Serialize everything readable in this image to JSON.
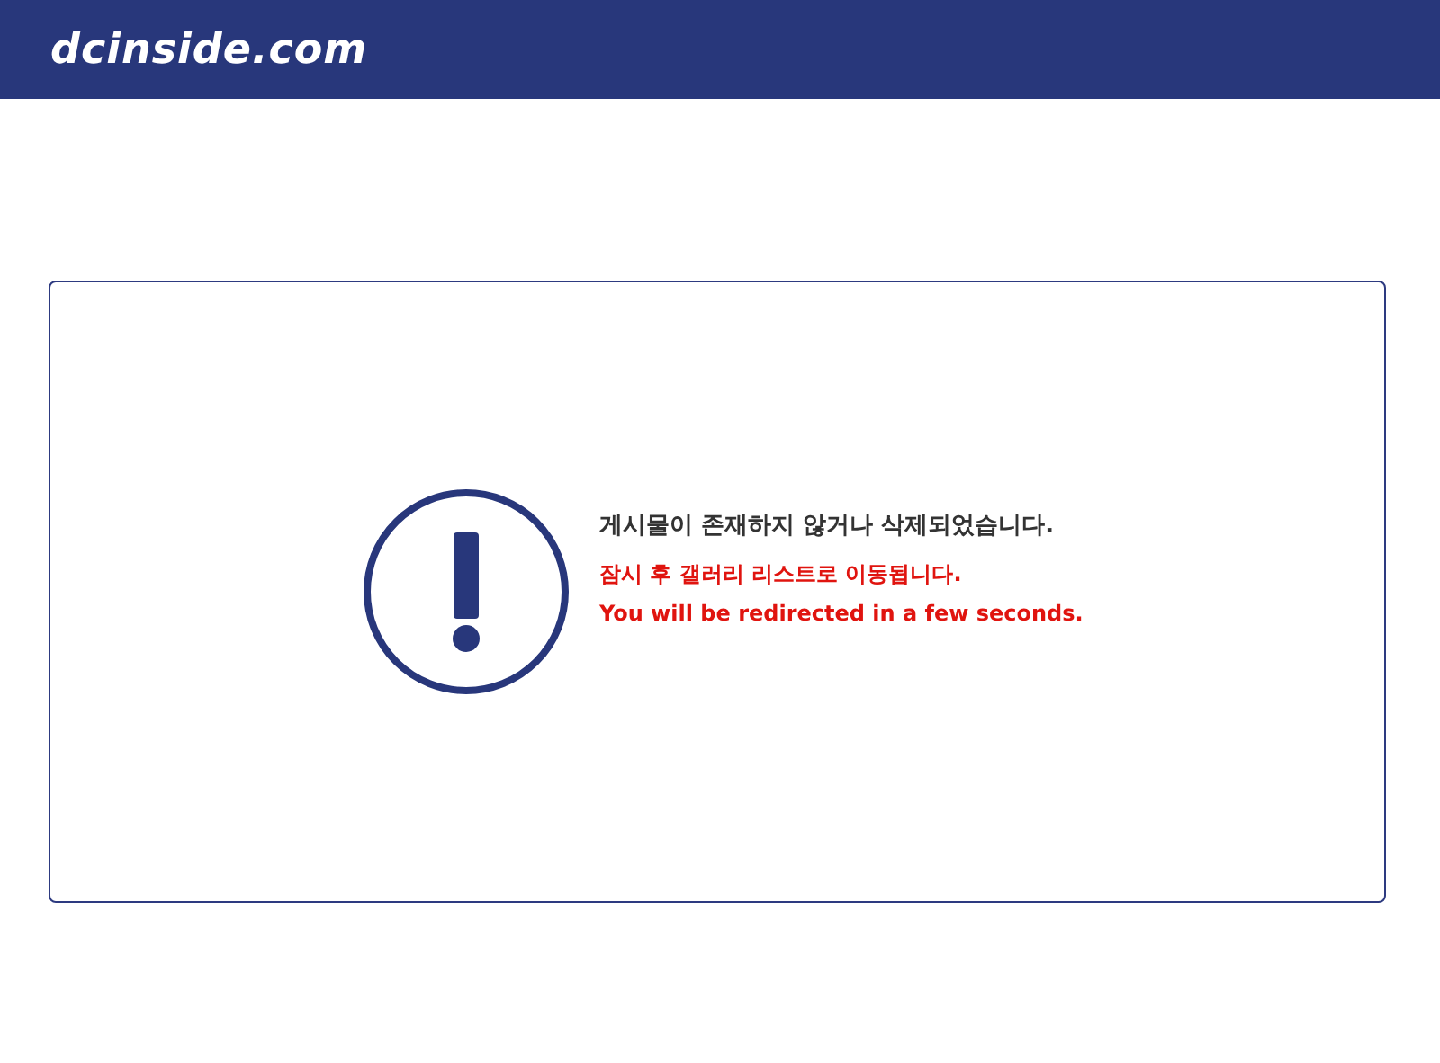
{
  "header": {
    "logo": "dcinside.com"
  },
  "message": {
    "lines": [
      {
        "kind": "main",
        "text": "게시물이 존재하지 않거나 삭제되었습니다."
      },
      {
        "kind": "notice",
        "text": "잠시 후 갤러리 리스트로 이동됩니다."
      },
      {
        "kind": "notice",
        "text": "You will be redirected in a few seconds."
      }
    ]
  }
}
